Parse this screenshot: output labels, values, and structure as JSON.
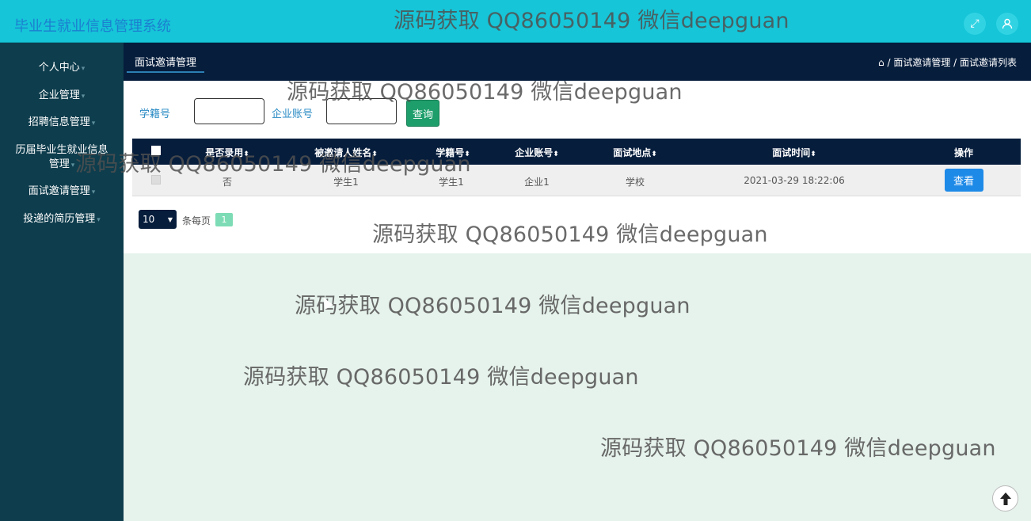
{
  "app": {
    "title": "毕业生就业信息管理系统"
  },
  "topbar": {
    "fullscreen_icon": "expand-icon",
    "user_icon": "user-icon"
  },
  "sidebar": {
    "items": [
      {
        "label": "个人中心"
      },
      {
        "label": "企业管理"
      },
      {
        "label": "招聘信息管理"
      },
      {
        "label": "历届毕业生就业信息管理"
      },
      {
        "label": "面试邀请管理"
      },
      {
        "label": "投递的简历管理"
      }
    ],
    "caret": "▾"
  },
  "header": {
    "tab": "面试邀请管理",
    "breadcrumb": "/ 面试邀请管理 / 面试邀请列表",
    "home_icon": "home-icon"
  },
  "search": {
    "field1_label": "学籍号",
    "field1_value": "",
    "field2_label": "企业账号",
    "field2_value": "",
    "button": "查询"
  },
  "table": {
    "headers": [
      "是否录用",
      "被邀请人姓名",
      "学籍号",
      "企业账号",
      "面试地点",
      "面试时间",
      "操作"
    ],
    "rows": [
      {
        "hired": "否",
        "name": "学生1",
        "student_id": "学生1",
        "company": "企业1",
        "location": "学校",
        "time": "2021-03-29 18:22:06",
        "action": "查看"
      }
    ]
  },
  "pager": {
    "page_size": "10",
    "per_page_label": "条每页",
    "current_page": "1"
  },
  "watermark": "源码获取 QQ86050149 微信deepguan",
  "colors": {
    "topbar": "#16c5d8",
    "sidebar": "#0e3d4d",
    "header": "#061d3c",
    "search_button": "#1e9e6b",
    "view_button": "#1e8ae8",
    "body_bg": "#e6f2ec"
  }
}
